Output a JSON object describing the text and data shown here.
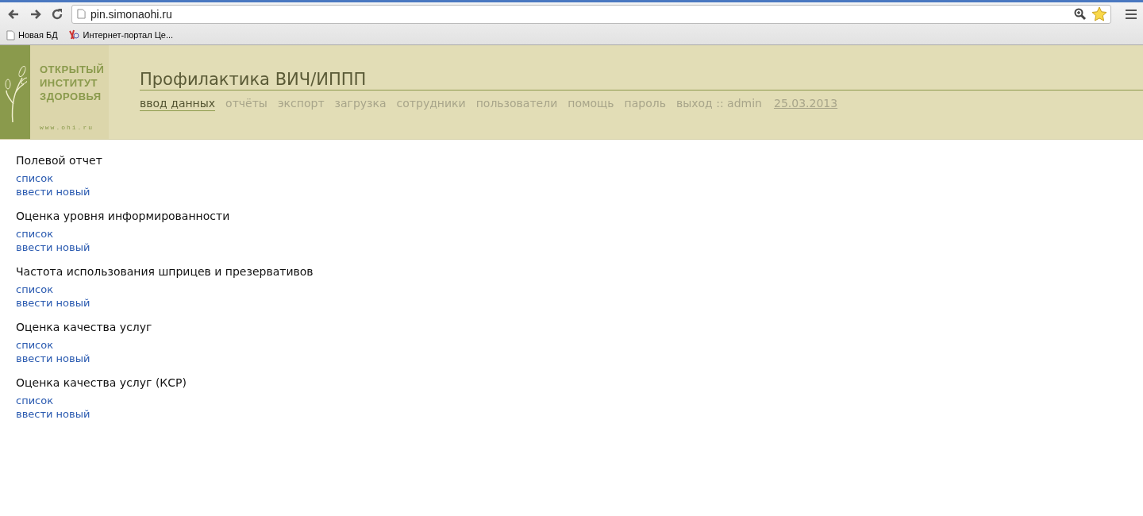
{
  "browser": {
    "url": "pin.simonaohi.ru",
    "bookmarks": [
      {
        "label": "Новая БД",
        "kind": "page"
      },
      {
        "label": "Интернет-портал Це...",
        "kind": "site"
      }
    ]
  },
  "header": {
    "logo_lines": [
      "ОТКРЫТЫЙ",
      "ИНСТИТУТ",
      "ЗДОРОВЬЯ"
    ],
    "logo_url": "www.ohi.ru",
    "title": "Профилактика ВИЧ/ИППП",
    "nav": [
      {
        "label": "ввод данных",
        "selected": true
      },
      {
        "label": "отчёты",
        "selected": false
      },
      {
        "label": "экспорт",
        "selected": false
      },
      {
        "label": "загрузка",
        "selected": false
      },
      {
        "label": "сотрудники",
        "selected": false
      },
      {
        "label": "пользователи",
        "selected": false
      },
      {
        "label": "помощь",
        "selected": false
      },
      {
        "label": "пароль",
        "selected": false
      },
      {
        "label": "выход :: admin",
        "selected": false
      }
    ],
    "date": "25.03.2013"
  },
  "sections": [
    {
      "title": "Полевой отчет",
      "links": [
        "список",
        "ввести новый"
      ]
    },
    {
      "title": "Оценка уровня информированности",
      "links": [
        "список",
        "ввести новый"
      ]
    },
    {
      "title": "Частота использования шприцев и презервативов",
      "links": [
        "список",
        "ввести новый"
      ]
    },
    {
      "title": "Оценка качества услуг",
      "links": [
        "список",
        "ввести новый"
      ]
    },
    {
      "title": "Оценка качества услуг (КСР)",
      "links": [
        "список",
        "ввести новый"
      ]
    }
  ]
}
